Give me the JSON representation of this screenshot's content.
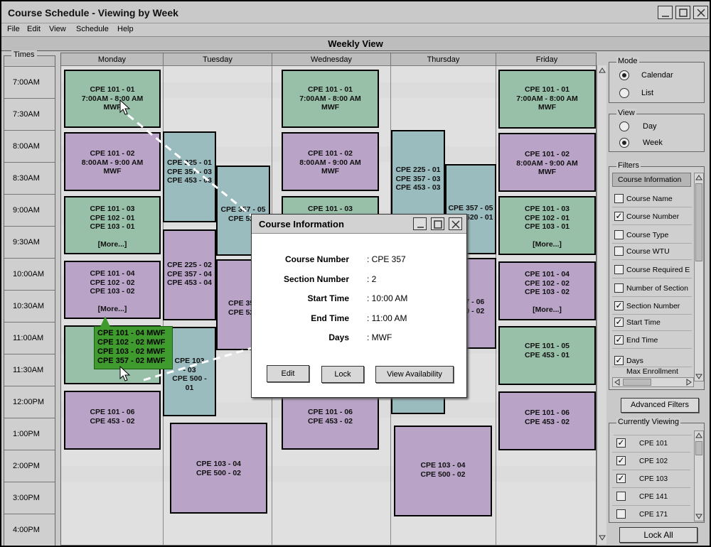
{
  "window": {
    "title": "Course Schedule - Viewing by Week"
  },
  "menu": [
    "File",
    "Edit",
    "View",
    "Schedule",
    "Help"
  ],
  "view_header": "Weekly View",
  "times_label": "Times",
  "times": [
    "7:00AM",
    "7:30AM",
    "8:00AM",
    "8:30AM",
    "9:00AM",
    "9:30AM",
    "10:00AM",
    "10:30AM",
    "11:00AM",
    "11:30AM",
    "12:00PM",
    "1:00PM",
    "2:00PM",
    "3:00PM",
    "4:00PM"
  ],
  "days": [
    "Monday",
    "Tuesday",
    "Wednesday",
    "Thursday",
    "Friday"
  ],
  "events": {
    "mon1": [
      "CPE 101 - 01",
      "7:00AM - 8:00 AM",
      "MWF"
    ],
    "mon2": [
      "CPE 101 - 02",
      "8:00AM - 9:00 AM",
      "MWF"
    ],
    "mon3": [
      "CPE 101 - 03",
      "CPE 102 - 01",
      "CPE 103 - 01",
      "",
      "[More...]"
    ],
    "mon4": [
      "CPE 101 - 04",
      "CPE 102 - 02",
      "CPE 103 - 02",
      "",
      "[More...]"
    ],
    "mon5": [
      "C",
      "",
      "",
      ""
    ],
    "mon6": [
      "CPE 101 - 06",
      "CPE 453 - 02"
    ],
    "tue1": [
      "",
      "CPE 225 - 01",
      "CPE 357 - 03",
      "CPE 453 - 03"
    ],
    "tue2": [
      "CPE 357 - 05",
      "CPE 520"
    ],
    "tue3": [
      "",
      "CPE 225 - 02",
      "CPE 357 - 04",
      "CPE 453 - 04"
    ],
    "tue4": [
      "CPE 357",
      "CPE 520"
    ],
    "tue5": [
      "CPE 103",
      "- 03",
      "CPE 500 -",
      "01"
    ],
    "tue6": [
      "CPE 103 - 04",
      "CPE 500 - 02"
    ],
    "wed1": [
      "CPE 101 - 01",
      "7:00AM - 8:00 AM",
      "MWF"
    ],
    "wed2": [
      "CPE 101 - 02",
      "8:00AM - 9:00 AM",
      "MWF"
    ],
    "wed3": [
      "CPE 101 - 03"
    ],
    "wed6": [
      "CPE 101 - 06",
      "CPE 453 - 02"
    ],
    "thu1": [
      "",
      "CPE 225 - 01",
      "CPE 357 - 03",
      "CPE 453 - 03"
    ],
    "thu2": [
      "CPE 357 - 05",
      "CPE 520 - 01"
    ],
    "thu3": [
      "357 - 06",
      "520 - 02"
    ],
    "thu6": [
      "CPE 103 - 04",
      "CPE 500 - 02"
    ],
    "fri1": [
      "CPE 101 - 01",
      "7:00AM - 8:00 AM",
      "MWF"
    ],
    "fri2": [
      "CPE 101 - 02",
      "8:00AM - 9:00 AM",
      "MWF"
    ],
    "fri3": [
      "CPE 101 - 03",
      "CPE 102 - 01",
      "CPE 103 - 01",
      "",
      "[More...]"
    ],
    "fri4": [
      "CPE 101 - 04",
      "CPE 102 - 02",
      "CPE 103 - 02",
      "",
      "[More...]"
    ],
    "fri5": [
      "CPE 101 - 05",
      "CPE 453 - 01"
    ],
    "fri6": [
      "CPE 101 - 06",
      "CPE 453 - 02"
    ]
  },
  "tooltip": [
    "CPE 101 - 04 MWF",
    "CPE 102 - 02 MWF",
    "CPE 103 - 02 MWF",
    "CPE 357 - 02 MWF"
  ],
  "dialog": {
    "title": "Course Information",
    "fields": [
      {
        "label": "Course Number",
        "value": ": CPE 357"
      },
      {
        "label": "Section Number",
        "value": ": 2"
      },
      {
        "label": "Start Time",
        "value": ": 10:00 AM"
      },
      {
        "label": "End Time",
        "value": ": 11:00 AM"
      },
      {
        "label": "Days",
        "value": ": MWF"
      }
    ],
    "buttons": {
      "edit": "Edit",
      "lock": "Lock",
      "availability": "View Availability"
    }
  },
  "mode": {
    "label": "Mode",
    "options": [
      "Calendar",
      "List"
    ],
    "selected": "Calendar"
  },
  "view": {
    "label": "View",
    "options": [
      "Day",
      "Week"
    ],
    "selected": "Week"
  },
  "filters": {
    "label": "Filters",
    "header": "Course Information",
    "items": [
      {
        "label": "Course Name",
        "checked": false
      },
      {
        "label": "Course Number",
        "checked": true
      },
      {
        "label": "Course Type",
        "checked": false
      },
      {
        "label": "Course WTU",
        "checked": false
      },
      {
        "label": "Course Required E",
        "checked": false
      },
      {
        "label": "Number of Section",
        "checked": false
      },
      {
        "label": "Section Number",
        "checked": true
      },
      {
        "label": "Start Time",
        "checked": true
      },
      {
        "label": "End Time",
        "checked": true
      },
      {
        "label": "Days",
        "checked": true
      },
      {
        "label": "Max Enrollment",
        "checked": false
      }
    ]
  },
  "advanced_filters": "Advanced Filters",
  "currently_viewing": {
    "label": "Currently Viewing",
    "items": [
      {
        "label": "CPE 101",
        "checked": true
      },
      {
        "label": "CPE 102",
        "checked": true
      },
      {
        "label": "CPE 103",
        "checked": true
      },
      {
        "label": "CPE 141",
        "checked": false
      },
      {
        "label": "CPE 171",
        "checked": false
      }
    ]
  },
  "lock_all": "Lock All",
  "colors": {
    "green": "#98bfa8",
    "purple": "#b9a4c8",
    "blue": "#9bbcbf",
    "tooltip": "#3f9b2d"
  }
}
